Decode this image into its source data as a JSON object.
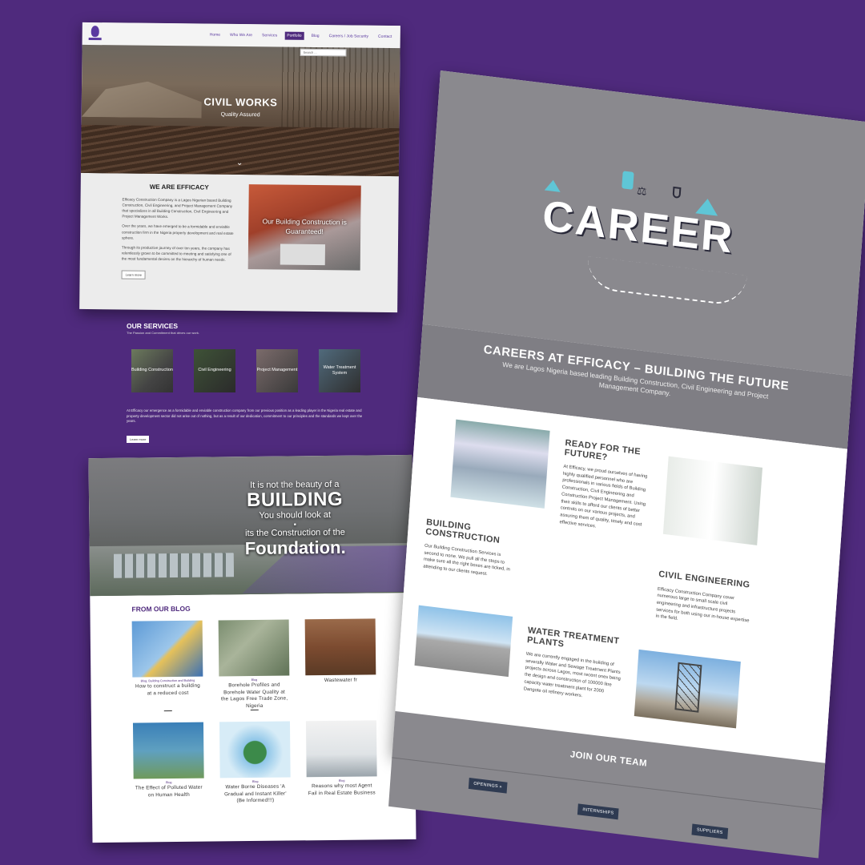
{
  "site_nav": {
    "items": [
      "Home",
      "Who We Are",
      "Services",
      "Portfolio",
      "Blog",
      "Careers / Job Security",
      "Contact"
    ],
    "search_placeholder": "Search ...",
    "active_index": 3
  },
  "hero": {
    "title": "CIVIL WORKS",
    "subtitle": "Quality Assured"
  },
  "about": {
    "heading": "WE ARE EFFICACY",
    "paragraphs": [
      "Efficacy Construction Company is a Lagos Nigerian based Building Construction, Civil Engineering, and Project Management Company that specializes in all Building Construction, Civil Engineering and Project Management Works.",
      "Over the years, we have emerged to be a formidable and enviable construction firm in the Nigeria property development and real estate sphere.",
      "Through its productive journey of over ten years, the company has relentlessly grown to be committed to meeting and satisfying one of the most fundamental desires on the hierarchy of human needs."
    ],
    "button": "Learn more",
    "image_caption": "Our Building Construction is Guaranteed!"
  },
  "services": {
    "heading": "OUR SERVICES",
    "subheading": "The Passion and Commitment that drives our work.",
    "tiles": [
      "Building Construction",
      "Civil Engineering",
      "Project Management",
      "Water Treatment System"
    ],
    "paragraph": "At Efficacy our emergence as a formidable and enviable construction company from our previous position as a leading player in the Nigeria real estate and property development sector did not arise out of nothing, but as a result of our dedication, commitment to our principles and the standards we kept over the years.",
    "button": "Learn more"
  },
  "quote": {
    "line1": "It is not the beauty of a",
    "line2": "BUILDING",
    "line3": "You should look at",
    "line4": "its the Construction of the",
    "line5": "Foundation."
  },
  "blog": {
    "heading": "FROM OUR BLOG",
    "posts": [
      {
        "category": "Blog, Building Construction and Building",
        "title": "How to construct a building at a reduced cost"
      },
      {
        "category": "Blog",
        "title": "Borehole Profiles and Borehole Water Quality at the Lagos Free Trade Zone, Nigeria"
      },
      {
        "category": "",
        "title": "Wastewater fr"
      },
      {
        "category": "Blog",
        "title": "The Effect of Polluted Water on Human Health"
      },
      {
        "category": "Blog",
        "title": "Water Borne Diseases 'A Gradual and Instant Killer' (Be Informed!!!)"
      },
      {
        "category": "Blog",
        "title": "Reasons why most Agent Fail in Real Estate Business"
      }
    ]
  },
  "careers": {
    "hero_word": "CAREER",
    "heading": "CAREERS AT EFFICACY – BUILDING THE FUTURE",
    "subheading": "We are Lagos Nigeria based leading Building Construction, Civil Engineering and Project Management Company.",
    "sections": [
      {
        "title": "READY FOR THE FUTURE?",
        "text": "At Efficacy, we proud ourselves of having highly qualified personnel who are professionals in various fields of Building Construction, Civil Engineering and Construction Project Management. Using their skills to afford our clients of better controls on our various projects, and assuring them of quality, timely and cost effective services."
      },
      {
        "title": "BUILDING CONSTRUCTION",
        "text": "Our Building Construction Services is second to none. We pull all the stops to make sure all the right boxes are ticked, in attending to our clients request."
      },
      {
        "title": "CIVIL ENGINEERING",
        "text": "Efficacy Construction Company cover numerous large to small scale civil engineering and infrastructure projects services for both using our in-house expertise in the field."
      },
      {
        "title": "WATER TREATMENT PLANTS",
        "text": "We are currently engaged in the building of severally Water and Sewage Treatment Plants projects across Lagos, most recent ones being the design and construction of 100000 litre capacity water treatment plant for 2000 Dangote oil refinery workers."
      }
    ],
    "join_heading": "JOIN OUR TEAM",
    "buttons": [
      "OPENINGS »",
      "INTERNSHIPS",
      "SUPPLIERS"
    ]
  },
  "colors": {
    "background": "#4f2a7d",
    "accent": "#4f2a7d",
    "career_grey": "#8a898e",
    "button_navy": "#2f3b52",
    "career_icon_cyan": "#5fc6d6"
  }
}
